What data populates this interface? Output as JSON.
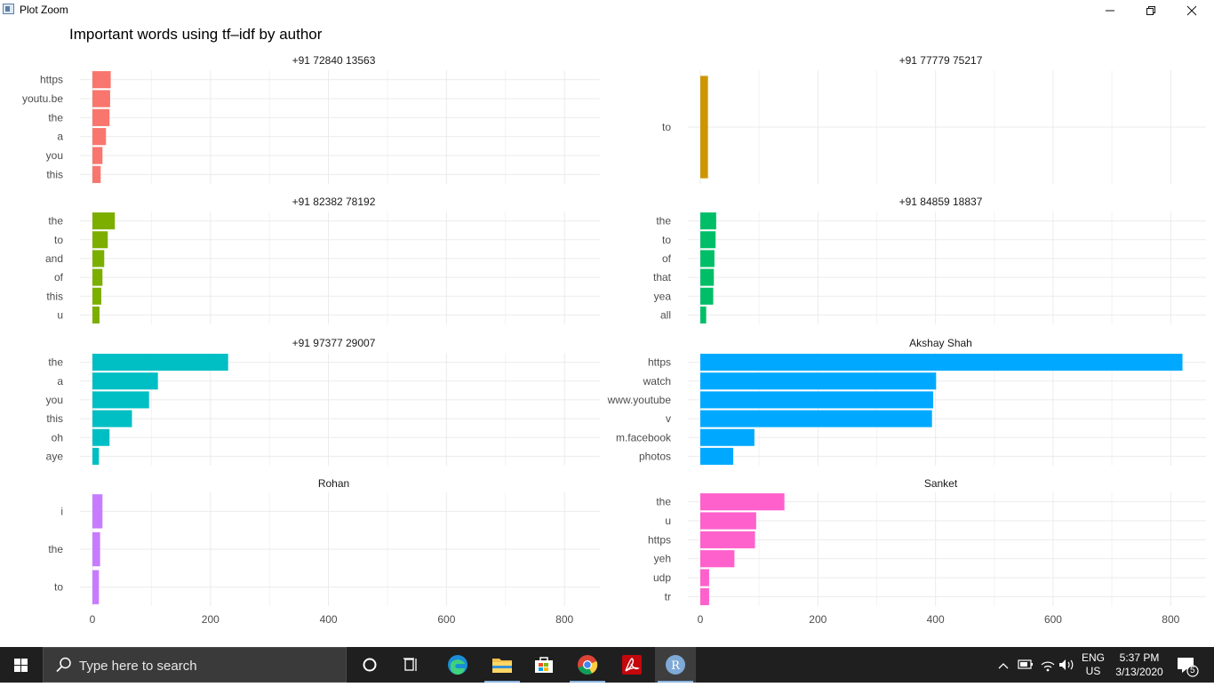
{
  "window": {
    "title": "Plot Zoom",
    "icons": [
      "rplot-app-icon",
      "minimize-icon",
      "maximize-icon",
      "close-icon"
    ]
  },
  "plot": {
    "title": "Important words using tf–idf by author",
    "x_ticks": [
      "0",
      "200",
      "400",
      "600",
      "800"
    ]
  },
  "chart_data": {
    "type": "bar",
    "orientation": "horizontal",
    "title": "Important words using tf–idf by author",
    "xlim": [
      0,
      860
    ],
    "x_ticks": [
      0,
      200,
      400,
      600,
      800
    ],
    "grid": true,
    "legend": "none",
    "panels": [
      {
        "name": "+91 72840 13563",
        "color": "#F8766D",
        "categories": [
          "https",
          "youtu.be",
          "the",
          "a",
          "you",
          "this"
        ],
        "values": [
          31,
          30,
          29,
          23,
          17,
          14
        ]
      },
      {
        "name": "+91 77779 75217",
        "color": "#CD9600",
        "categories": [
          "to"
        ],
        "values": [
          13
        ]
      },
      {
        "name": "+91 82382 78192",
        "color": "#7CAE00",
        "categories": [
          "the",
          "to",
          "and",
          "of",
          "this",
          "u"
        ],
        "values": [
          38,
          26,
          20,
          17,
          15,
          12
        ]
      },
      {
        "name": "+91 84859 18837",
        "color": "#00BE67",
        "categories": [
          "the",
          "to",
          "of",
          "that",
          "yea",
          "all"
        ],
        "values": [
          27,
          26,
          24,
          23,
          22,
          10
        ]
      },
      {
        "name": "+91 97377 29007",
        "color": "#00BFC4",
        "categories": [
          "the",
          "a",
          "you",
          "this",
          "oh",
          "aye"
        ],
        "values": [
          230,
          111,
          96,
          67,
          29,
          11
        ]
      },
      {
        "name": "Akshay Shah",
        "color": "#00A9FF",
        "categories": [
          "https",
          "watch",
          "www.youtube",
          "v",
          "m.facebook",
          "photos"
        ],
        "values": [
          820,
          401,
          396,
          394,
          92,
          56
        ]
      },
      {
        "name": "Rohan",
        "color": "#C77CFF",
        "categories": [
          "i",
          "the",
          "to"
        ],
        "values": [
          17,
          13,
          11
        ]
      },
      {
        "name": "Sanket",
        "color": "#FF61CC",
        "categories": [
          "the",
          "u",
          "https",
          "yeh",
          "udp",
          "tr"
        ],
        "values": [
          143,
          95,
          93,
          58,
          15,
          15
        ]
      }
    ]
  },
  "taskbar": {
    "search_placeholder": "Type here to search",
    "pinned_apps": [
      "cortana-icon",
      "task-view-icon",
      "edge-icon",
      "file-explorer-icon",
      "microsoft-store-icon",
      "chrome-icon",
      "acrobat-icon",
      "r-icon"
    ],
    "tray": {
      "lang_top": "ENG",
      "lang_bottom": "US",
      "time": "5:37 PM",
      "date": "3/13/2020",
      "notification_count": "5"
    }
  }
}
